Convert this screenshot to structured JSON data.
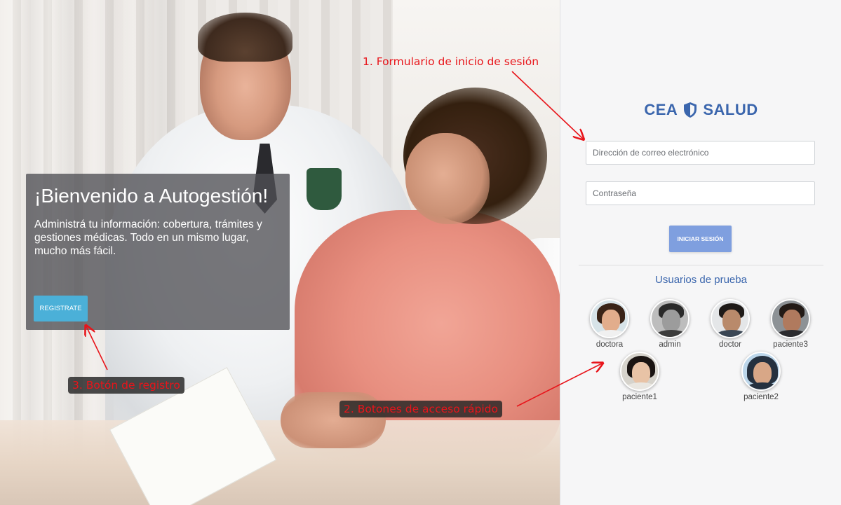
{
  "hero": {
    "title": "¡Bienvenido a Autogestión!",
    "description": "Administrá tu información: cobertura, trámites y gestiones médicas. Todo en un mismo lugar, mucho más fácil.",
    "register_label": "REGISTRATE"
  },
  "login": {
    "logo_left": "CEA",
    "logo_right": "SALUD",
    "logo_icon": "shield-icon",
    "email_placeholder": "Dirección de correo electrónico",
    "password_placeholder": "Contraseña",
    "submit_label": "INICIAR SESIÓN"
  },
  "test_users": {
    "title": "Usuarios de prueba",
    "users": [
      {
        "label": "doctora"
      },
      {
        "label": "admin"
      },
      {
        "label": "doctor"
      },
      {
        "label": "paciente3"
      },
      {
        "label": "paciente1"
      },
      {
        "label": "paciente2"
      }
    ]
  },
  "annotations": {
    "form": "1. Formulario de inicio de sesión",
    "quick_access": "2. Botones de acceso rápido",
    "register": "3. Botón de registro"
  },
  "colors": {
    "brand_blue": "#3b66ad",
    "login_button": "#7f9fdf",
    "register_button": "#4bb0d8",
    "annotation_red": "#e8141a"
  }
}
